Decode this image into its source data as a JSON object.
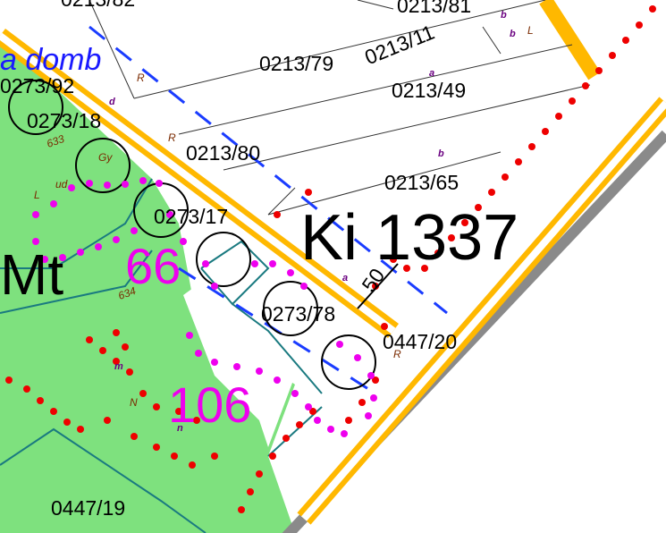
{
  "map": {
    "colors": {
      "green_zone": "#7ee17e",
      "road": "#ffb800",
      "red_dots": "#ee0000",
      "magenta_dots": "#ee00ee",
      "teal_boundary": "#1a7a80",
      "blue_dash": "#1a3cff",
      "grey_shadow": "#8a8a8a"
    },
    "street_label": "a domb",
    "zone_code": "Ki 1337",
    "zone_mt": "Mt",
    "zone_66": "66",
    "zone_106": "106",
    "distance_label": "50",
    "parcels": {
      "p_0213_82": "0213/82",
      "p_0213_81": "0213/81",
      "p_0213_79": "0213/79",
      "p_0213_11": "0213/11",
      "p_0213_49": "0213/49",
      "p_0273_92": "0273/92",
      "p_0273_18": "0273/18",
      "p_0213_80": "0213/80",
      "p_0213_65": "0213/65",
      "p_0273_17": "0273/17",
      "p_0273_78": "0273/78",
      "p_0447_20": "0447/20",
      "p_0447_19": "0447/19"
    },
    "codes": {
      "c_633": "633",
      "c_634": "634",
      "c_b1": "b",
      "c_b2": "b",
      "c_b3": "b",
      "c_a1": "a",
      "c_a2": "a",
      "c_d": "d",
      "c_m": "m",
      "c_n": "n",
      "c_R1": "R",
      "c_R2": "R",
      "c_R3": "R",
      "c_L1": "L",
      "c_L2": "L",
      "c_N": "N",
      "c_Gy": "Gy",
      "c_ud": "ud"
    }
  }
}
